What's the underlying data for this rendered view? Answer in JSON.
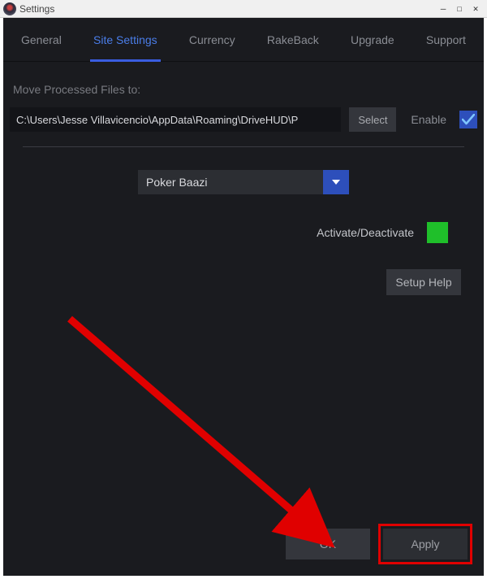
{
  "window": {
    "title": "Settings"
  },
  "tabs": [
    {
      "label": "General",
      "active": false
    },
    {
      "label": "Site Settings",
      "active": true
    },
    {
      "label": "Currency",
      "active": false
    },
    {
      "label": "RakeBack",
      "active": false
    },
    {
      "label": "Upgrade",
      "active": false
    },
    {
      "label": "Support",
      "active": false
    }
  ],
  "moveFiles": {
    "label": "Move Processed Files to:",
    "path": "C:\\Users\\Jesse Villavicencio\\AppData\\Roaming\\DriveHUD\\P",
    "selectLabel": "Select",
    "enableLabel": "Enable",
    "enabled": true
  },
  "siteDropdown": {
    "selected": "Poker Baazi"
  },
  "activate": {
    "label": "Activate/Deactivate",
    "state": true
  },
  "setupHelp": {
    "label": "Setup Help"
  },
  "footer": {
    "ok": "OK",
    "apply": "Apply"
  },
  "annotation": {
    "highlightColor": "#e00000",
    "arrowColor": "#e00000"
  }
}
